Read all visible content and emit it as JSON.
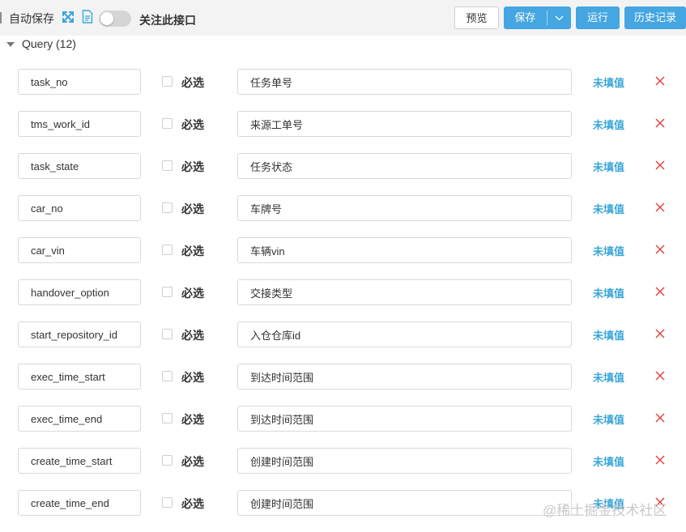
{
  "toolbar": {
    "autosave_label": "自动保存",
    "expand_icon": "expand-arrows-icon",
    "doc_icon": "document-icon",
    "toggle_on": false,
    "follow_label": "关注此接口",
    "preview_label": "预览",
    "save_label": "保存",
    "run_label": "运行",
    "history_label": "历史记录",
    "accent_color": "#45a6e1"
  },
  "section": {
    "title": "Query (12)"
  },
  "params": [
    {
      "name": "task_no",
      "required_label": "必选",
      "desc": "任务单号",
      "value_label": "未填值"
    },
    {
      "name": "tms_work_id",
      "required_label": "必选",
      "desc": "来源工单号",
      "value_label": "未填值"
    },
    {
      "name": "task_state",
      "required_label": "必选",
      "desc": "任务状态",
      "value_label": "未填值"
    },
    {
      "name": "car_no",
      "required_label": "必选",
      "desc": "车牌号",
      "value_label": "未填值"
    },
    {
      "name": "car_vin",
      "required_label": "必选",
      "desc": "车辆vin",
      "value_label": "未填值"
    },
    {
      "name": "handover_option",
      "required_label": "必选",
      "desc": "交接类型",
      "value_label": "未填值"
    },
    {
      "name": "start_repository_id",
      "required_label": "必选",
      "desc": "入仓仓库id",
      "value_label": "未填值"
    },
    {
      "name": "exec_time_start",
      "required_label": "必选",
      "desc": "到达时间范围",
      "value_label": "未填值"
    },
    {
      "name": "exec_time_end",
      "required_label": "必选",
      "desc": "到达时间范围",
      "value_label": "未填值"
    },
    {
      "name": "create_time_start",
      "required_label": "必选",
      "desc": "创建时间范围",
      "value_label": "未填值"
    },
    {
      "name": "create_time_end",
      "required_label": "必选",
      "desc": "创建时间范围",
      "value_label": "未填值"
    }
  ],
  "watermark": "@稀土掘金技术社区"
}
